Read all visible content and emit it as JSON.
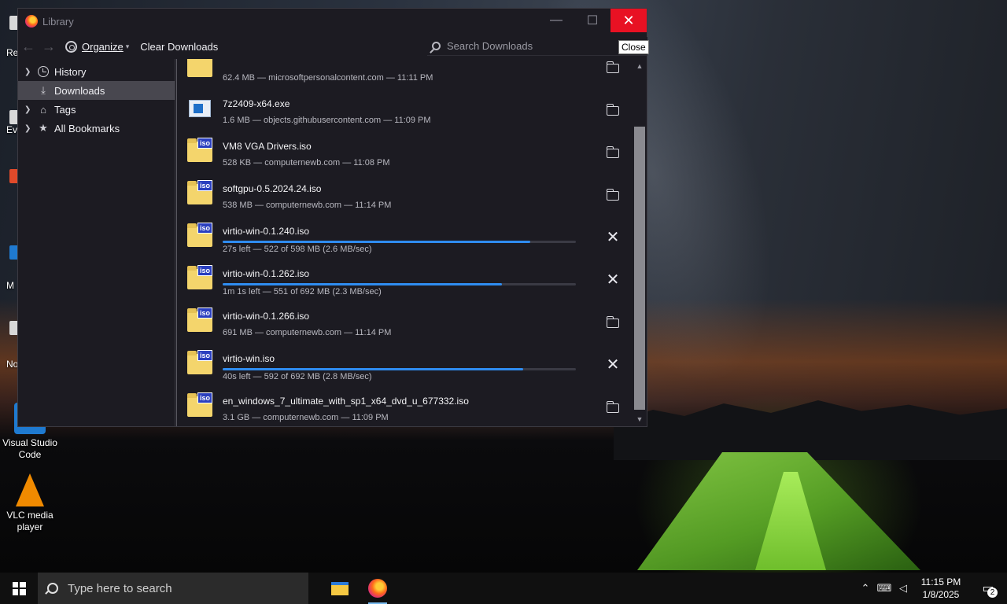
{
  "window": {
    "title": "Library",
    "close_tooltip": "Close",
    "controls": {
      "minimize": "—",
      "maximize": "☐",
      "close": "✕"
    }
  },
  "toolbar": {
    "back": "←",
    "forward": "→",
    "organize_label": "Organize",
    "clear_label": "Clear Downloads",
    "search_placeholder": "Search Downloads"
  },
  "sidebar": {
    "items": [
      {
        "label": "History",
        "icon": "clock-icon",
        "expandable": true
      },
      {
        "label": "Downloads",
        "icon": "download-icon",
        "expandable": false,
        "selected": true
      },
      {
        "label": "Tags",
        "icon": "tag-icon",
        "expandable": true
      },
      {
        "label": "All Bookmarks",
        "icon": "star-icon",
        "expandable": true
      }
    ]
  },
  "downloads": [
    {
      "name": "",
      "meta": "62.4 MB — microsoftpersonalcontent.com — 11:11 PM",
      "type": "folder",
      "status": "done"
    },
    {
      "name": "7z2409-x64.exe",
      "meta": "1.6 MB — objects.githubusercontent.com — 11:09 PM",
      "type": "exe",
      "status": "done"
    },
    {
      "name": "VM8 VGA Drivers.iso",
      "meta": "528 KB — computernewb.com — 11:08 PM",
      "type": "iso",
      "status": "done"
    },
    {
      "name": "softgpu-0.5.2024.24.iso",
      "meta": "538 MB — computernewb.com — 11:14 PM",
      "type": "iso",
      "status": "done"
    },
    {
      "name": "virtio-win-0.1.240.iso",
      "meta": "27s left — 522 of 598 MB (2.6 MB/sec)",
      "type": "iso",
      "status": "downloading",
      "progress": 0.87
    },
    {
      "name": "virtio-win-0.1.262.iso",
      "meta": "1m 1s left — 551 of 692 MB (2.3 MB/sec)",
      "type": "iso",
      "status": "downloading",
      "progress": 0.79
    },
    {
      "name": "virtio-win-0.1.266.iso",
      "meta": "691 MB — computernewb.com — 11:14 PM",
      "type": "iso",
      "status": "done"
    },
    {
      "name": "virtio-win.iso",
      "meta": "40s left — 592 of 692 MB (2.8 MB/sec)",
      "type": "iso",
      "status": "downloading",
      "progress": 0.85
    },
    {
      "name": "en_windows_7_ultimate_with_sp1_x64_dvd_u_677332.iso",
      "meta": "3.1 GB — computernewb.com — 11:09 PM",
      "type": "iso",
      "status": "done"
    }
  ],
  "iso_badge": "iso",
  "desktop": {
    "icons": [
      {
        "label": "Visual Studio Code",
        "icon": "vscode-icon"
      },
      {
        "label": "VLC media player",
        "icon": "vlc-icon"
      }
    ],
    "partial_labels": [
      "Re",
      "Ev",
      "M",
      "No"
    ]
  },
  "taskbar": {
    "search_placeholder": "Type here to search",
    "time": "11:15 PM",
    "date": "1/8/2025",
    "notification_count": "2"
  }
}
